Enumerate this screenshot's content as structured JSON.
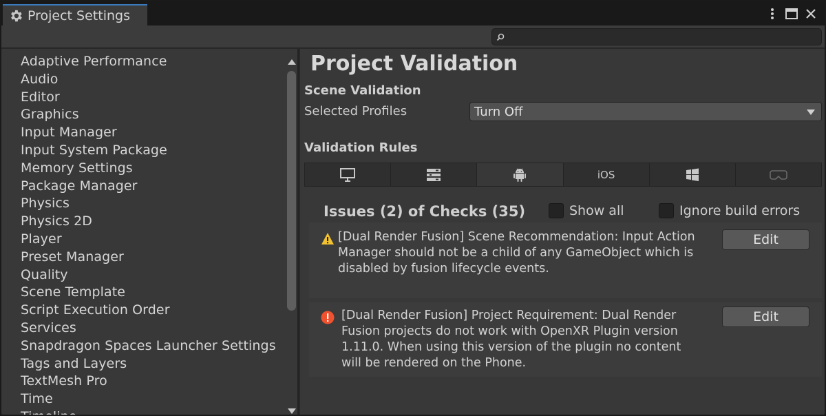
{
  "window": {
    "tab_title": "Project Settings",
    "search": {
      "value": "",
      "placeholder": ""
    }
  },
  "sidebar": {
    "items": [
      "Adaptive Performance",
      "Audio",
      "Editor",
      "Graphics",
      "Input Manager",
      "Input System Package",
      "Memory Settings",
      "Package Manager",
      "Physics",
      "Physics 2D",
      "Player",
      "Preset Manager",
      "Quality",
      "Scene Template",
      "Script Execution Order",
      "Services",
      "Snapdragon Spaces Launcher Settings",
      "Tags and Layers",
      "TextMesh Pro",
      "Time",
      "Timeline"
    ]
  },
  "main": {
    "title": "Project Validation",
    "scene_validation": {
      "heading": "Scene Validation",
      "profiles_label": "Selected Profiles",
      "profiles_value": "Turn Off"
    },
    "validation_rules_heading": "Validation Rules",
    "platform_tabs": [
      {
        "icon": "monitor-icon",
        "label": ""
      },
      {
        "icon": "server-icon",
        "label": ""
      },
      {
        "icon": "android-icon",
        "label": "",
        "active": true
      },
      {
        "icon": "",
        "label": "iOS"
      },
      {
        "icon": "windows-icon",
        "label": ""
      },
      {
        "icon": "headset-icon",
        "label": ""
      }
    ],
    "issues": {
      "heading": "Issues (2) of Checks (35)",
      "show_all_label": "Show all",
      "ignore_build_errors_label": "Ignore build errors",
      "list": [
        {
          "severity": "warning",
          "text": "[Dual Render Fusion] Scene Recommendation: Input Action Manager should not be a child of any GameObject which is disabled by fusion lifecycle events.",
          "button": "Edit"
        },
        {
          "severity": "error",
          "text": "[Dual Render Fusion] Project Requirement: Dual Render Fusion projects do not work with OpenXR Plugin version 1.11.0. When using this version of the plugin no content will be rendered on the Phone.",
          "button": "Edit"
        }
      ]
    }
  },
  "colors": {
    "tab_accent": "#3a79bb",
    "warning": "#f2c230",
    "error": "#f0522f"
  }
}
